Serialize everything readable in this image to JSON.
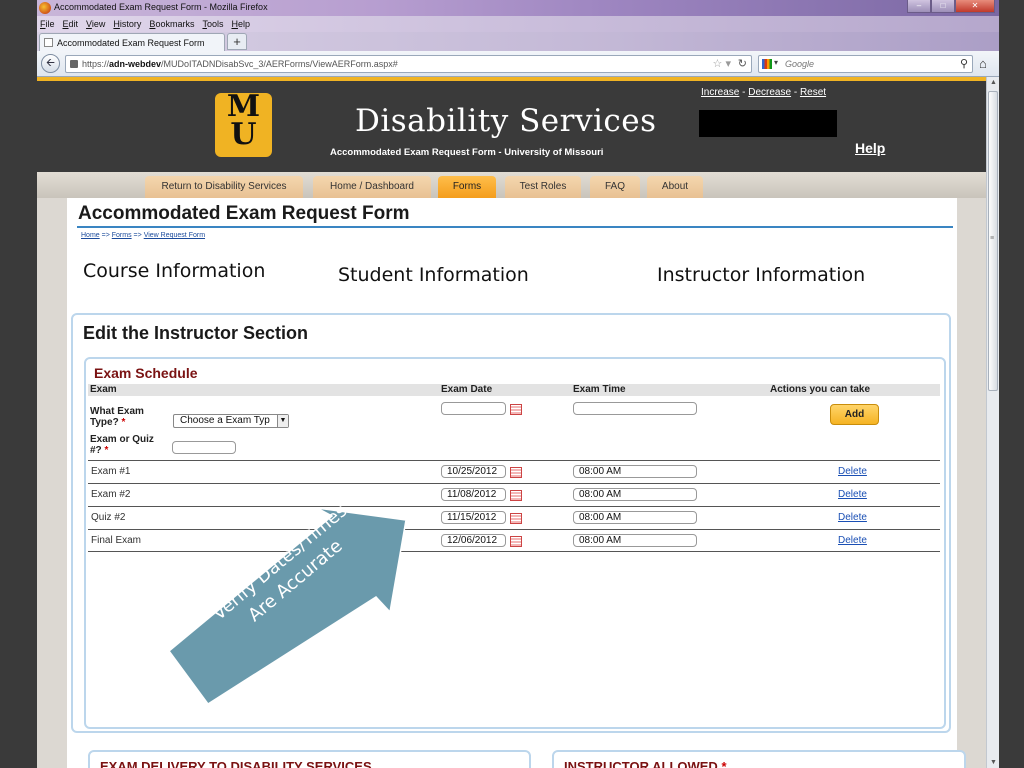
{
  "browser": {
    "window_title": "Accommodated Exam Request Form - Mozilla Firefox",
    "menu": [
      "File",
      "Edit",
      "View",
      "History",
      "Bookmarks",
      "Tools",
      "Help"
    ],
    "tab_label": "Accommodated Exam Request Form",
    "new_tab_label": "+",
    "url_prefix": "https://",
    "url_host": "adn-webdev",
    "url_path": "/MUDoITADNDisabSvc_3/AERForms/ViewAERForm.aspx#",
    "search_placeholder": "Google"
  },
  "site": {
    "logo_top": "M",
    "logo_bottom": "U",
    "title": "Disability Services",
    "subtitle": "Accommodated Exam Request Form - University of Missouri",
    "text_size": {
      "increase": "Increase",
      "sep": " - ",
      "decrease": "Decrease",
      "reset": "Reset"
    },
    "help": "Help",
    "nav": [
      "Return to Disability Services",
      "Home / Dashboard",
      "Forms",
      "Test Roles",
      "FAQ",
      "About"
    ],
    "active_nav": "Forms"
  },
  "page": {
    "title": "Accommodated Exam Request Form",
    "breadcrumb": {
      "home": "Home",
      "arrow": " => ",
      "forms": "Forms",
      "current": "View Request Form"
    },
    "sections": [
      "Course Information",
      "Student Information",
      "Instructor Information"
    ]
  },
  "edit": {
    "title": "Edit the Instructor Section",
    "schedule": {
      "title": "Exam Schedule",
      "columns": [
        "Exam",
        "Exam Date",
        "Exam Time",
        "Actions you can take"
      ],
      "exam_type_label": "What Exam Type?",
      "exam_type_value": "Choose a Exam Typ",
      "exam_num_label": "Exam or Quiz #?",
      "required_mark": "*",
      "add_button": "Add",
      "rows": [
        {
          "name": "Exam #1",
          "date": "10/25/2012",
          "time": "08:00 AM",
          "action": "Delete"
        },
        {
          "name": "Exam #2",
          "date": "11/08/2012",
          "time": "08:00 AM",
          "action": "Delete"
        },
        {
          "name": "Quiz #2",
          "date": "11/15/2012",
          "time": "08:00 AM",
          "action": "Delete"
        },
        {
          "name": "Final Exam",
          "date": "12/06/2012",
          "time": "08:00 AM",
          "action": "Delete"
        }
      ]
    }
  },
  "lower": {
    "delivery_title": "EXAM DELIVERY TO DISABILITY SERVICES",
    "allowed_title": "INSTRUCTOR ALLOWED",
    "required_mark": "*"
  },
  "annotation": {
    "line1": "Verify Dates/Times",
    "line2": "Are Accurate",
    "color": "#6a9aac"
  }
}
